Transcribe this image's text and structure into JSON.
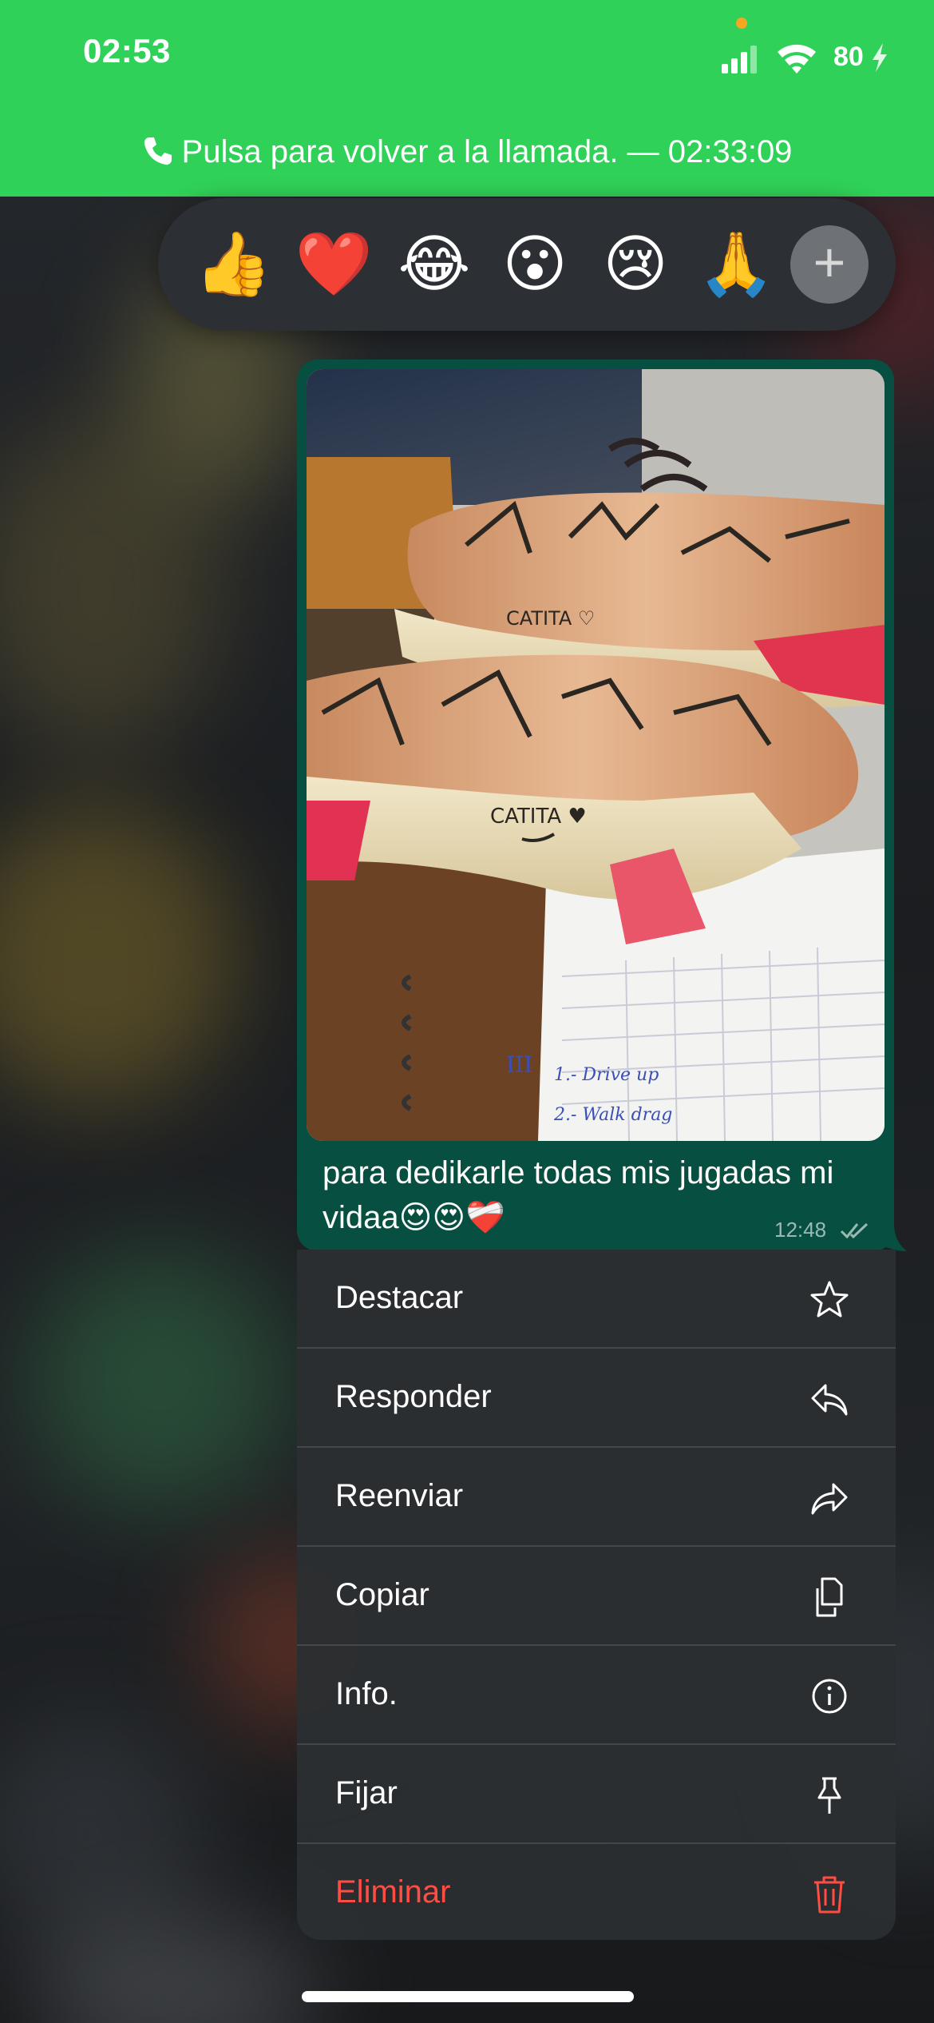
{
  "status_bar": {
    "time": "02:53",
    "battery": "80",
    "accent_color": "#30d158"
  },
  "call_banner": {
    "text": "Pulsa para volver a la llamada. — 02:33:09"
  },
  "reactions": {
    "emojis": [
      "👍",
      "❤️",
      "😂",
      "😮",
      "😢",
      "🙏"
    ],
    "more_icon": "plus-icon",
    "more_label": "+"
  },
  "message": {
    "image_icon": "photo-football-boots",
    "caption": "para dedikarle todas mis jugadas mi vidaa😍😍❤️‍🩹",
    "time": "12:48",
    "status_icon": "double-check-icon",
    "bubble_color": "#075041"
  },
  "context_menu": {
    "items": [
      {
        "label": "Destacar",
        "icon": "star-icon"
      },
      {
        "label": "Responder",
        "icon": "reply-icon"
      },
      {
        "label": "Reenviar",
        "icon": "forward-icon"
      },
      {
        "label": "Copiar",
        "icon": "copy-icon"
      },
      {
        "label": "Info.",
        "icon": "info-icon"
      },
      {
        "label": "Fijar",
        "icon": "pin-icon"
      },
      {
        "label": "Eliminar",
        "icon": "trash-icon",
        "color": "#ff4d43"
      }
    ]
  }
}
